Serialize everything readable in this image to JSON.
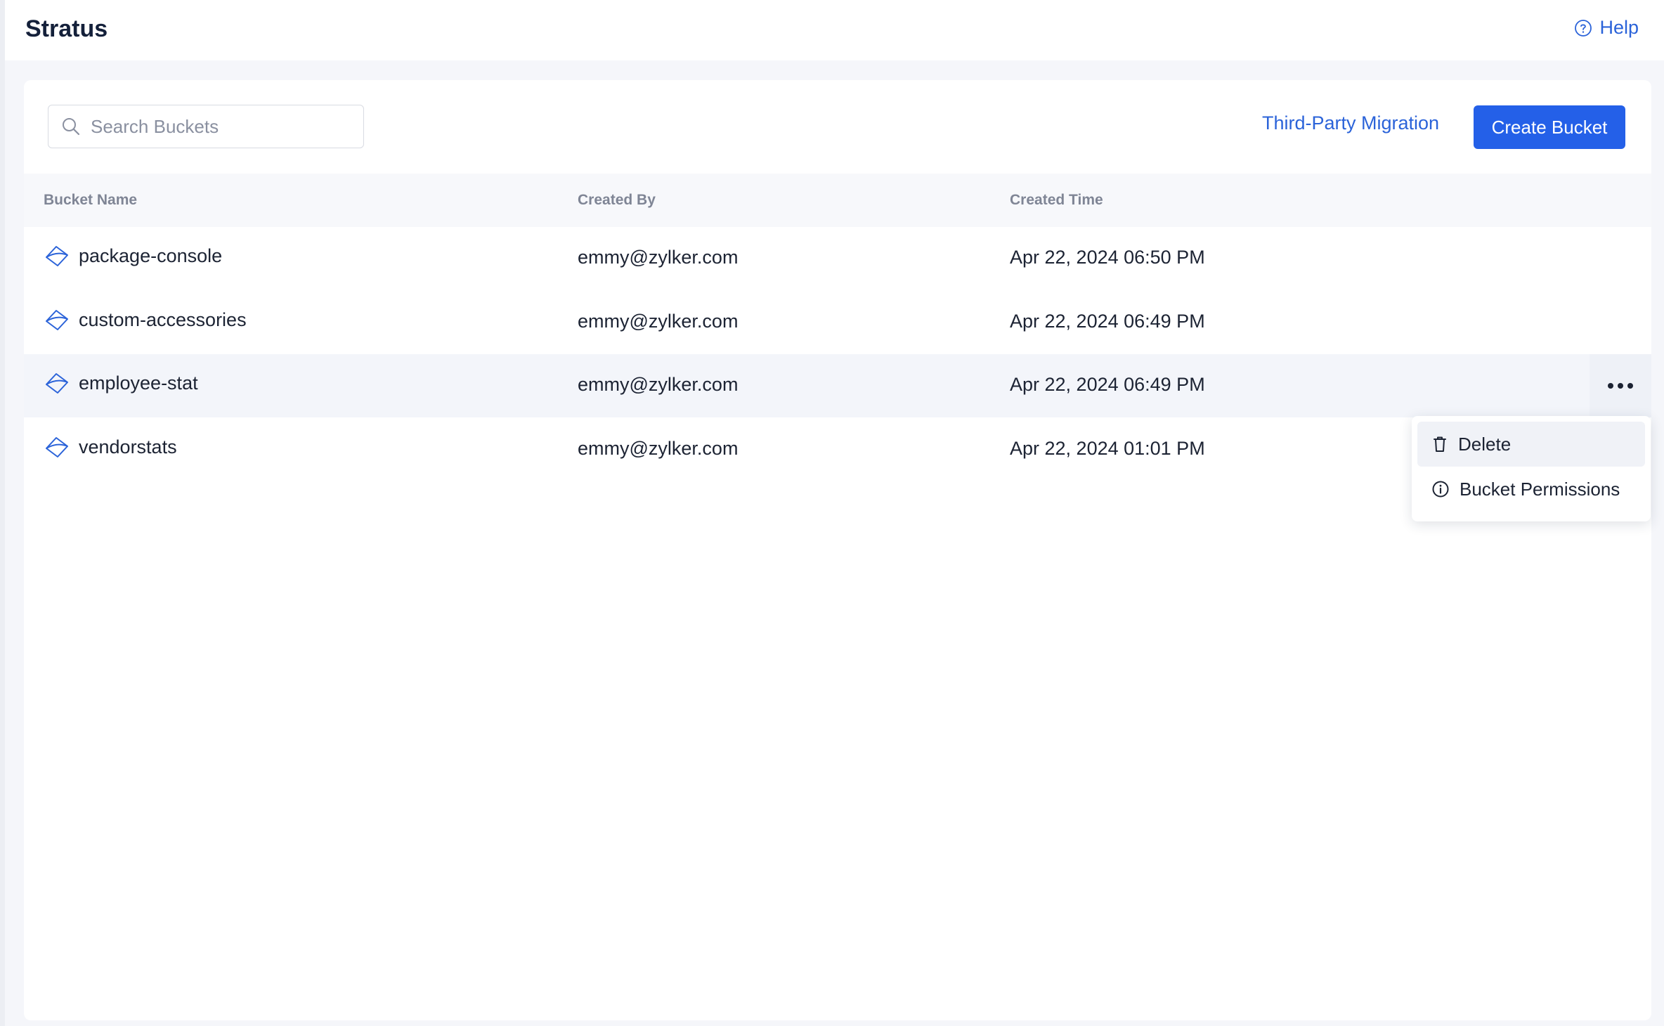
{
  "app": {
    "title": "Stratus",
    "help_label": "Help"
  },
  "toolbar": {
    "search_placeholder": "Search Buckets",
    "search_value": "",
    "migration_label": "Third-Party Migration",
    "create_label": "Create Bucket"
  },
  "table": {
    "headers": [
      "Bucket Name",
      "Created By",
      "Created Time"
    ],
    "rows": [
      {
        "name": "package-console",
        "created_by": "emmy@zylker.com",
        "created_time": "Apr 22, 2024 06:50 PM"
      },
      {
        "name": "custom-accessories",
        "created_by": "emmy@zylker.com",
        "created_time": "Apr 22, 2024 06:49 PM"
      },
      {
        "name": "employee-stat",
        "created_by": "emmy@zylker.com",
        "created_time": "Apr 22, 2024 06:49 PM"
      },
      {
        "name": "vendorstats",
        "created_by": "emmy@zylker.com",
        "created_time": "Apr 22, 2024 01:01 PM"
      }
    ]
  },
  "context_menu": {
    "items": [
      {
        "label": "Delete",
        "icon": "trash-icon"
      },
      {
        "label": "Bucket Permissions",
        "icon": "info-icon"
      }
    ]
  },
  "colors": {
    "accent": "#2460e8",
    "link": "#2b63d9",
    "row_hover": "#f3f5fa"
  }
}
